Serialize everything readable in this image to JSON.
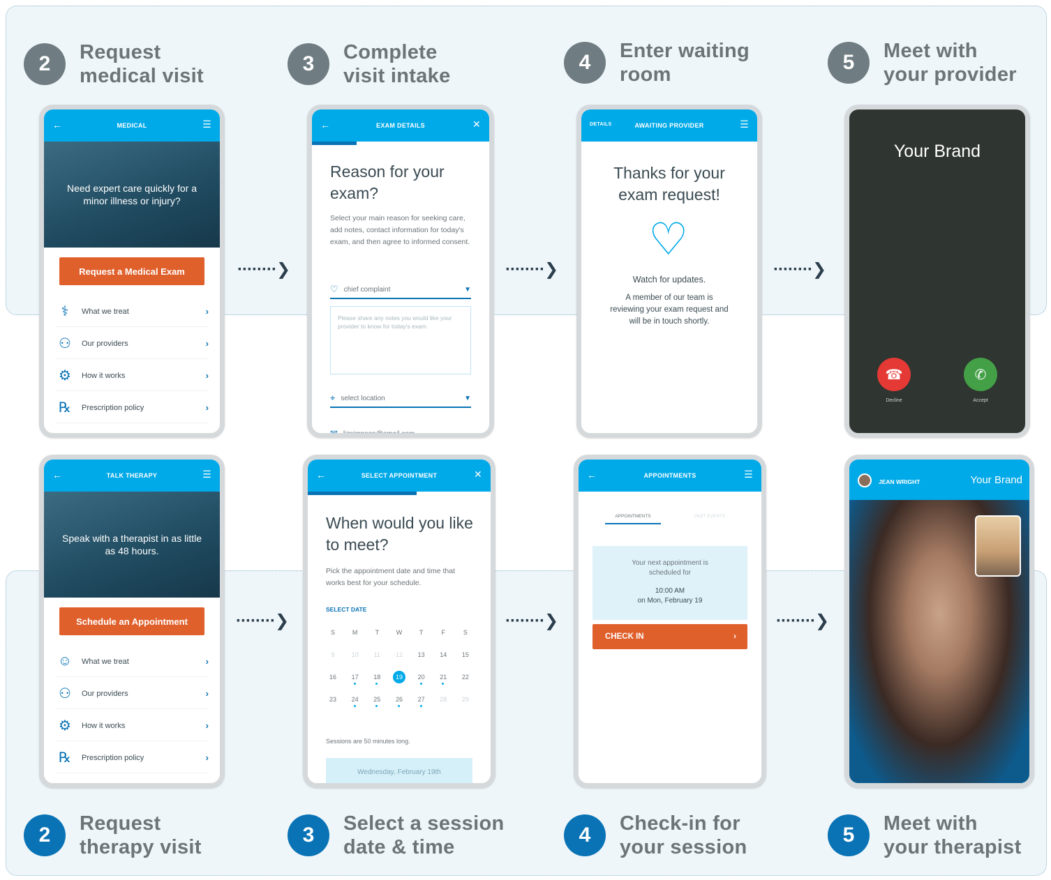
{
  "medical_flow": {
    "steps": [
      {
        "number": "2",
        "line1": "Request",
        "line2": "medical visit"
      },
      {
        "number": "3",
        "line1": "Complete",
        "line2": "visit intake"
      },
      {
        "number": "4",
        "line1": "Enter waiting",
        "line2": "room"
      },
      {
        "number": "5",
        "line1": "Meet with",
        "line2": "your provider"
      }
    ],
    "screen1": {
      "title": "MEDICAL",
      "hero_text": "Need expert care quickly for a minor illness or injury?",
      "cta": "Request a Medical Exam",
      "menu": [
        "What we treat",
        "Our providers",
        "How it works",
        "Prescription policy"
      ]
    },
    "screen2": {
      "title": "EXAM DETAILS",
      "heading": "Reason for your exam?",
      "body": "Select your main reason for seeking care, add notes, contact information for today's exam, and then agree to informed consent.",
      "complaint_placeholder": "chief complaint",
      "notes_placeholder": "Please share any notes you would like your provider to know for today's exam.",
      "location_placeholder": "select location",
      "email_value": "lizsimpson@email.com"
    },
    "screen3": {
      "title": "AWAITING PROVIDER",
      "left_tab": "DETAILS",
      "heading": "Thanks for your exam request!",
      "watch": "Watch for updates.",
      "body": "A member of our team is reviewing your exam request and will be in touch shortly."
    },
    "screen4": {
      "brand": "Your Brand",
      "decline_label": "Decline",
      "accept_label": "Accept"
    }
  },
  "therapy_flow": {
    "steps": [
      {
        "number": "2",
        "line1": "Request",
        "line2": "therapy visit"
      },
      {
        "number": "3",
        "line1": "Select a session",
        "line2": "date & time"
      },
      {
        "number": "4",
        "line1": "Check-in for",
        "line2": "your session"
      },
      {
        "number": "5",
        "line1": "Meet with",
        "line2": "your therapist"
      }
    ],
    "screen1": {
      "title": "TALK THERAPY",
      "hero_text": "Speak with a therapist in as little as 48 hours.",
      "cta": "Schedule an Appointment",
      "menu": [
        "What we treat",
        "Our providers",
        "How it works",
        "Prescription policy"
      ]
    },
    "screen2": {
      "title": "SELECT APPOINTMENT",
      "heading": "When would you like to meet?",
      "body": "Pick the appointment date and time that works best for your schedule.",
      "select_date_label": "SELECT DATE",
      "weekdays": [
        "S",
        "M",
        "T",
        "W",
        "T",
        "F",
        "S"
      ],
      "week1": [
        "9",
        "10",
        "11",
        "12",
        "13",
        "14",
        "15"
      ],
      "week2": [
        "16",
        "17",
        "18",
        "19",
        "20",
        "21",
        "22"
      ],
      "week3": [
        "23",
        "24",
        "25",
        "26",
        "27",
        "28",
        "29"
      ],
      "note": "Sessions are 50 minutes long.",
      "selected_date": "Wednesday, February 19th"
    },
    "screen3": {
      "title": "APPOINTMENTS",
      "tab_active": "APPOINTMENTS",
      "tab_inactive": "PAST EVENTS",
      "next_text": "Your next appointment is scheduled for",
      "time": "10:00 AM",
      "date": "on Mon, February 19",
      "checkin": "CHECK IN"
    },
    "screen4": {
      "caller": "JEAN WRIGHT",
      "brand": "Your Brand"
    }
  }
}
